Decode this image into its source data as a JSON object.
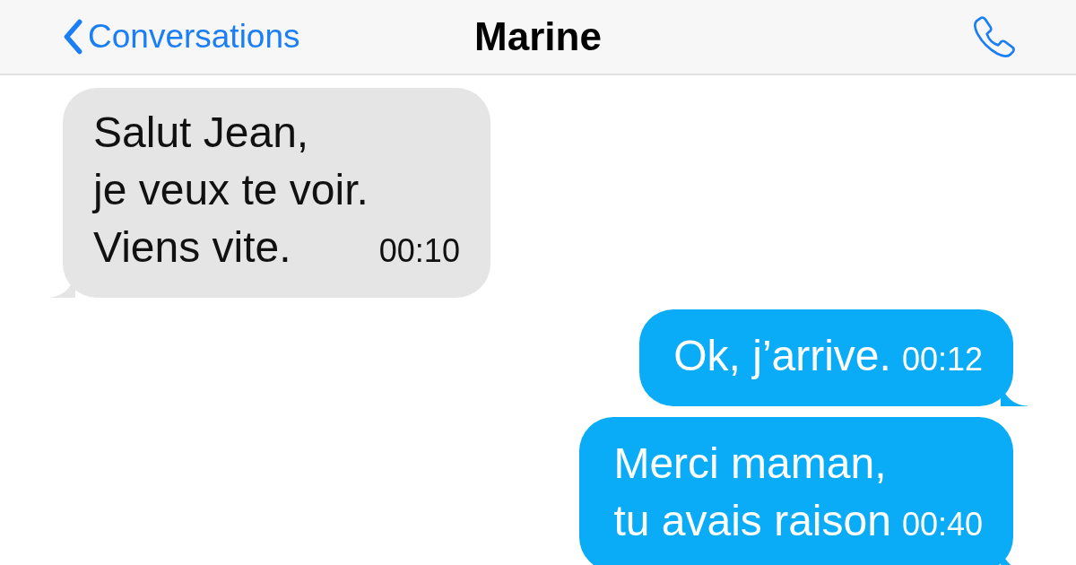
{
  "header": {
    "back_label": "Conversations",
    "title": "Marine"
  },
  "messages": [
    {
      "kind": "received",
      "lines": [
        "Salut Jean,",
        "je veux te voir.",
        "Viens vite."
      ],
      "time": "00:10"
    },
    {
      "kind": "sent",
      "lines": [
        "Ok, j’arrive."
      ],
      "time": "00:12"
    },
    {
      "kind": "sent",
      "lines": [
        "Merci maman,",
        "tu avais raison"
      ],
      "time": "00:40"
    }
  ]
}
